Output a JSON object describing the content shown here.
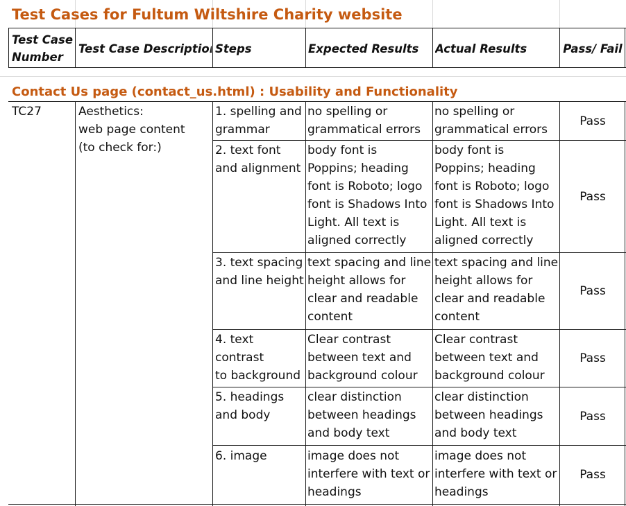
{
  "title": "Test Cases for Fultum Wiltshire Charity website",
  "headers": {
    "number_line1": "Test Case",
    "number_line2": "Number",
    "description": "Test Case Description",
    "steps": "Steps",
    "expected": "Expected Results",
    "actual": "Actual Results",
    "pass_fail": "Pass/ Fail"
  },
  "section": "Contact Us page (contact_us.html) : Usability  and Functionality",
  "test_case": {
    "number": "TC27",
    "description": "Aesthetics:\nweb page content\n(to check for:)"
  },
  "rows": [
    {
      "step": "1. spelling and\ngrammar",
      "expected": "no spelling or\ngrammatical errors",
      "actual": "no spelling or\ngrammatical errors",
      "result": "Pass"
    },
    {
      "step": "2. text font\nand alignment",
      "expected": "body font is\nPoppins; heading\nfont is Roboto; logo\nfont is Shadows Into\nLight.  All text is\naligned correctly",
      "actual": "body font is\nPoppins; heading\nfont is Roboto; logo\nfont is Shadows Into\nLight.  All text is\naligned correctly",
      "result": "Pass"
    },
    {
      "step": "3. text spacing\nand line height",
      "expected": "text spacing and line\nheight allows for\nclear and readable\ncontent",
      "actual": "text spacing and line\nheight allows for\nclear and readable\ncontent",
      "result": "Pass"
    },
    {
      "step": "4. text contrast\nto background",
      "expected": "Clear contrast\nbetween text and\nbackground colour",
      "actual": "Clear contrast\nbetween text and\nbackground colour",
      "result": "Pass"
    },
    {
      "step": "5. headings\nand body",
      "expected": "clear distinction\nbetween headings\nand body text",
      "actual": "clear distinction\nbetween headings\nand body text",
      "result": "Pass"
    },
    {
      "step": "6. image",
      "expected": "image does not\ninterfere with text or\nheadings",
      "actual": "image does not\ninterfere with text or\nheadings",
      "result": "Pass"
    }
  ]
}
